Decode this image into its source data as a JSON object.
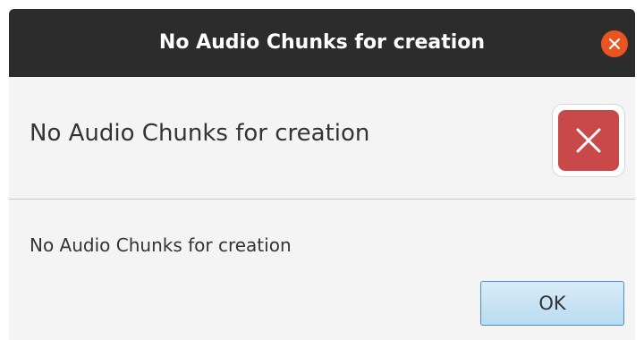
{
  "window": {
    "title": "No Audio Chunks for creation",
    "close_icon": "close-icon"
  },
  "header": {
    "text": "No Audio Chunks for creation",
    "icon": "error-icon"
  },
  "content": {
    "text": "No Audio Chunks for creation"
  },
  "buttons": {
    "ok_label": "OK"
  },
  "colors": {
    "titlebar": "#2c2c2c",
    "close_button": "#e95420",
    "error_icon": "#c9494b",
    "ok_button_border": "#4a8fc9"
  }
}
